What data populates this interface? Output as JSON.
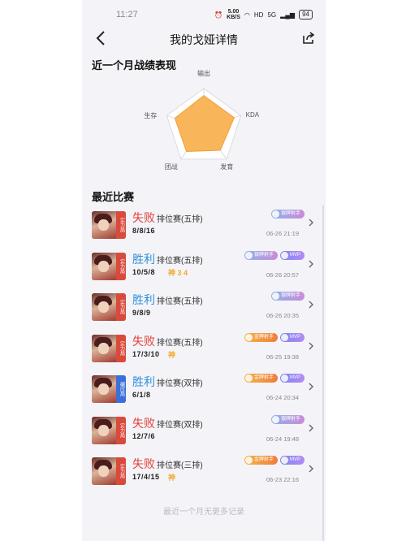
{
  "status": {
    "time": "11:27",
    "net_speed": "5.00",
    "net_unit": "KB/S",
    "signal": "HD",
    "network": "5G",
    "battery": "94"
  },
  "nav": {
    "title": "我的戈娅详情"
  },
  "radar": {
    "section_title": "近一个月战绩表现",
    "axes": [
      "输出",
      "KDA",
      "发育",
      "团战",
      "生存"
    ],
    "values": [
      0.82,
      0.82,
      0.72,
      0.76,
      0.78
    ],
    "colors": {
      "fill": "#f8b55a",
      "stroke": "#f2a03a",
      "grid": "#d9dbe3"
    }
  },
  "recent": {
    "section_title": "最近比赛",
    "matches": [
      {
        "tag": "实力局",
        "tag_color": "red",
        "result": "失败",
        "result_type": "lose",
        "mode": "排位赛(五排)",
        "kda": "8/8/16",
        "medal": "",
        "badges": [
          {
            "type": "silver",
            "label": "银牌射手"
          }
        ],
        "time": "06-26 21:19"
      },
      {
        "tag": "实力局",
        "tag_color": "red",
        "result": "胜利",
        "result_type": "win",
        "mode": "排位赛(五排)",
        "kda": "10/5/8",
        "medal": "神 3 4",
        "badges": [
          {
            "type": "silver",
            "label": "银牌射手"
          },
          {
            "type": "mvp",
            "label": "MVP"
          }
        ],
        "time": "06-26 20:57"
      },
      {
        "tag": "实力局",
        "tag_color": "red",
        "result": "胜利",
        "result_type": "win",
        "mode": "排位赛(五排)",
        "kda": "9/8/9",
        "medal": "",
        "badges": [
          {
            "type": "silver",
            "label": "银牌射手"
          }
        ],
        "time": "06-26 20:35"
      },
      {
        "tag": "实力局",
        "tag_color": "red",
        "result": "失败",
        "result_type": "lose",
        "mode": "排位赛(五排)",
        "kda": "17/3/10",
        "medal": "神",
        "badges": [
          {
            "type": "gold",
            "label": "金牌射手"
          },
          {
            "type": "mvp",
            "label": "MVP"
          }
        ],
        "time": "06-25 19:38"
      },
      {
        "tag": "碾压局",
        "tag_color": "blue",
        "result": "胜利",
        "result_type": "win",
        "mode": "排位赛(双排)",
        "kda": "6/1/8",
        "medal": "",
        "badges": [
          {
            "type": "gold",
            "label": "金牌射手"
          },
          {
            "type": "mvp",
            "label": "MVP"
          }
        ],
        "time": "06-24 20:34"
      },
      {
        "tag": "实力局",
        "tag_color": "red",
        "result": "失败",
        "result_type": "lose",
        "mode": "排位赛(双排)",
        "kda": "12/7/6",
        "medal": "",
        "badges": [
          {
            "type": "silver",
            "label": "银牌射手"
          }
        ],
        "time": "06-24 19:48"
      },
      {
        "tag": "实力局",
        "tag_color": "red",
        "result": "失败",
        "result_type": "lose",
        "mode": "排位赛(三排)",
        "kda": "17/4/15",
        "medal": "神",
        "badges": [
          {
            "type": "gold",
            "label": "金牌射手"
          },
          {
            "type": "mvp",
            "label": "MVP"
          }
        ],
        "time": "06-23 22:16"
      }
    ]
  },
  "footer": {
    "text": "最近一个月无更多记录"
  }
}
